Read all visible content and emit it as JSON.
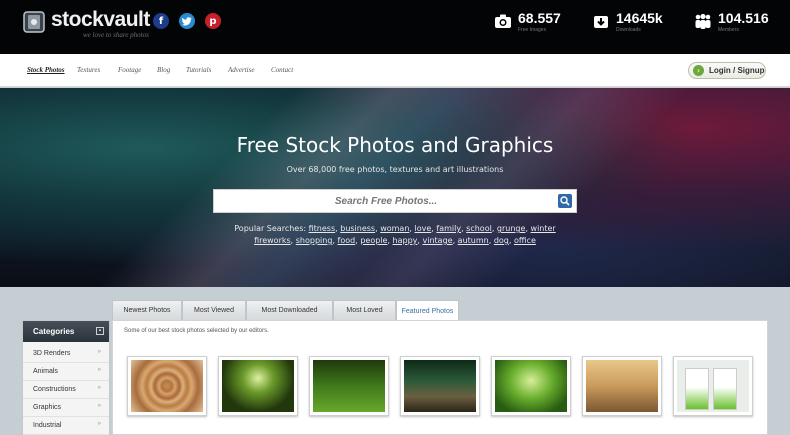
{
  "brand": {
    "name": "stockvault",
    "tagline": "we love to share photos"
  },
  "social": {
    "facebook": "f",
    "twitter": "t",
    "pinterest": "p"
  },
  "stats": [
    {
      "icon": "camera-icon",
      "value": "68.557",
      "label": "Free Images"
    },
    {
      "icon": "download-icon",
      "value": "14645k",
      "label": "Downloads"
    },
    {
      "icon": "members-icon",
      "value": "104.516",
      "label": "Members"
    }
  ],
  "nav": {
    "items": [
      "Stock Photos",
      "Textures",
      "Footage",
      "Blog",
      "Tutorials",
      "Advertise",
      "Contact"
    ],
    "active": "Stock Photos",
    "login_label": "Login / Signup"
  },
  "hero": {
    "title": "Free Stock Photos and Graphics",
    "subtitle": "Over 68,000 free photos, textures and art illustrations",
    "search_placeholder": "Search Free Photos...",
    "popular_label": "Popular Searches:",
    "popular_searches": [
      "fitness",
      "business",
      "woman",
      "love",
      "family",
      "school",
      "grunge",
      "winter",
      "fireworks",
      "shopping",
      "food",
      "people",
      "happy",
      "vintage",
      "autumn",
      "dog",
      "office"
    ]
  },
  "tabs": [
    "Newest Photos",
    "Most Viewed",
    "Most Downloaded",
    "Most Loved",
    "Featured Photos"
  ],
  "active_tab": "Featured Photos",
  "featured_note": "Some of our best stock photos selected by our editors.",
  "categories": {
    "title": "Categories",
    "items": [
      "3D Renders",
      "Animals",
      "Constructions",
      "Graphics",
      "Industrial"
    ]
  },
  "colors": {
    "topbar": "#030406",
    "accent": "#3a6fa0",
    "login_green": "#6ea83a"
  }
}
